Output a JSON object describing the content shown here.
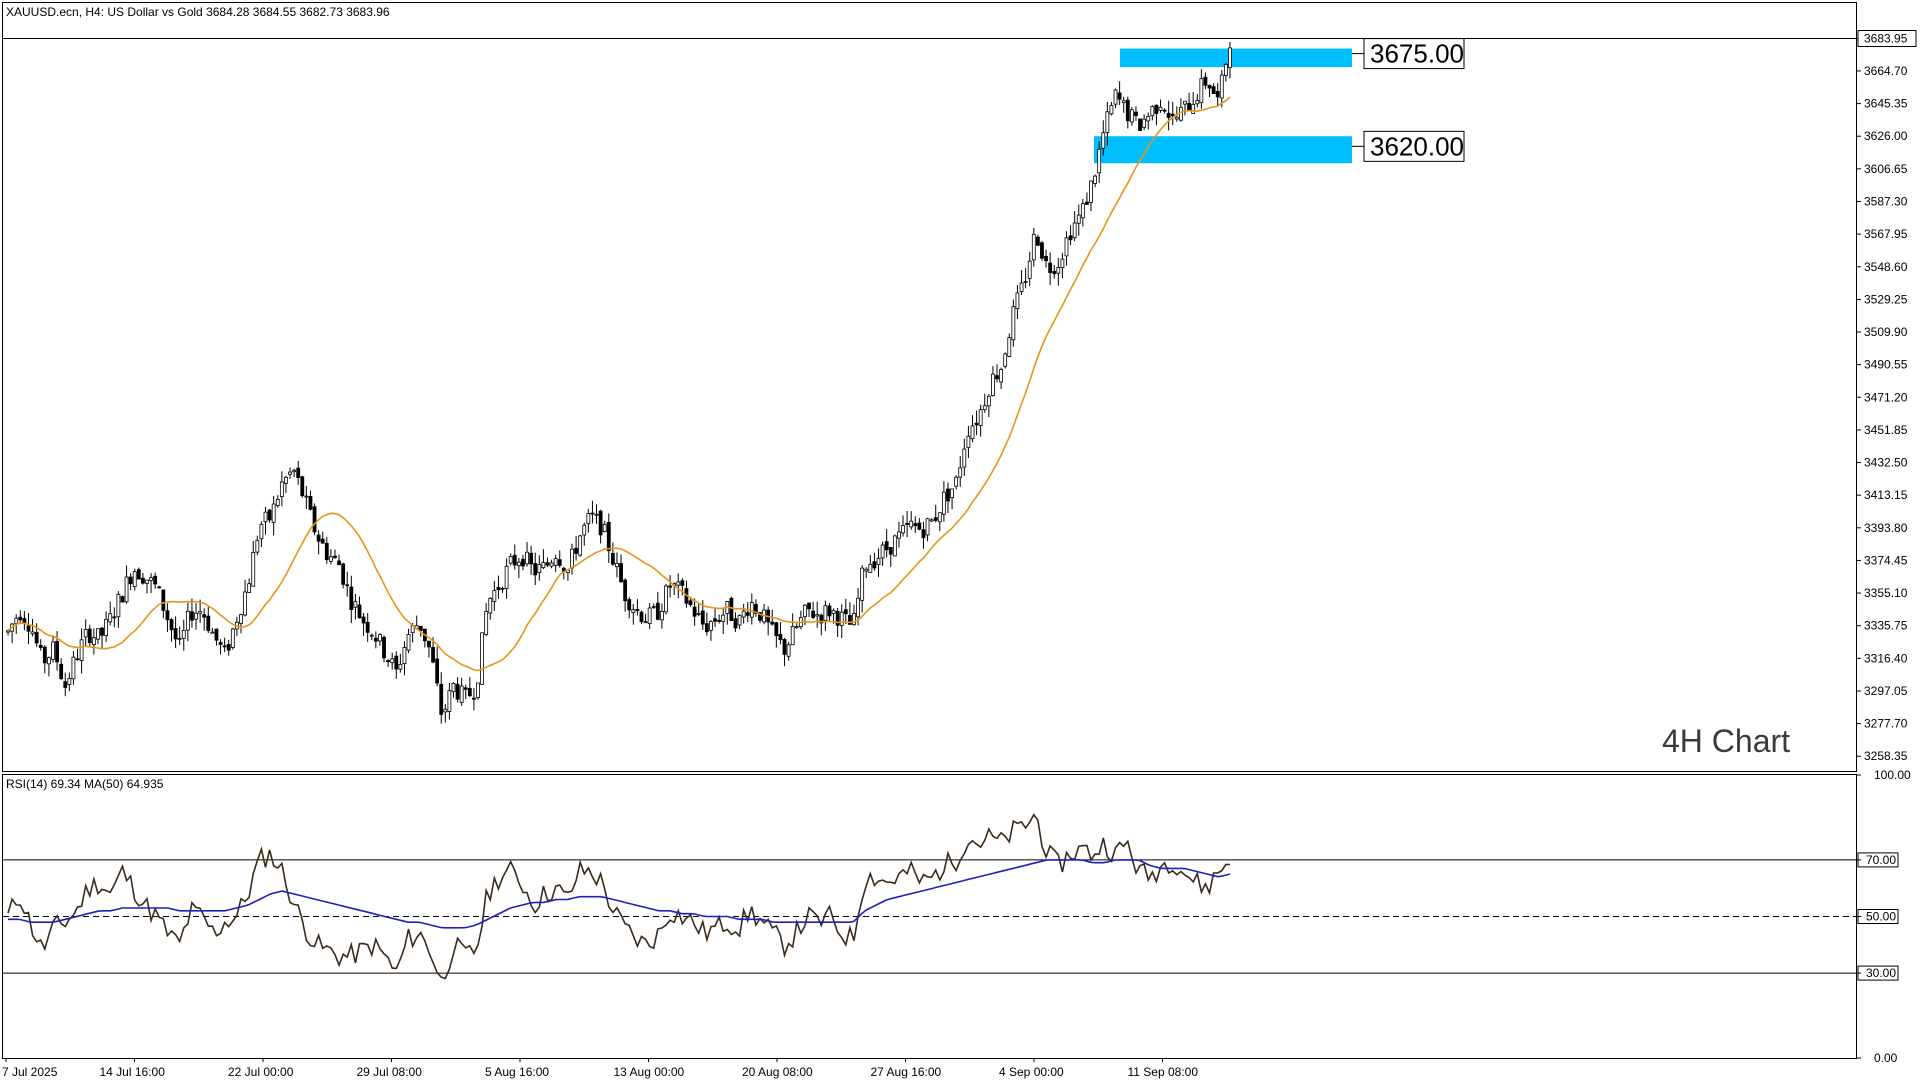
{
  "header": {
    "instrument_info": "XAUUSD.ecn, H4:  US Dollar vs Gold  3684.28 3684.55 3682.73 3683.96"
  },
  "annotation": {
    "timeframe_label": "4H Chart"
  },
  "colors": {
    "bull_candle": "#000000",
    "bear_candle": "#000000",
    "ma_line": "#e8941a",
    "zone_fill": "#00bfff",
    "rsi_line": "#3a2a1a",
    "rsi_ma_line": "#1f1fbf",
    "frame": "#000000"
  },
  "chart_data": [
    {
      "type": "candlestick",
      "title": "XAUUSD.ecn, H4",
      "ylim": [
        3249,
        3705
      ],
      "y_ticks": [
        "3683.95",
        "3664.70",
        "3645.35",
        "3626.00",
        "3606.65",
        "3587.30",
        "3567.95",
        "3548.60",
        "3529.25",
        "3509.90",
        "3490.55",
        "3471.20",
        "3451.85",
        "3432.50",
        "3413.15",
        "3393.80",
        "3374.45",
        "3355.10",
        "3335.75",
        "3316.40",
        "3297.05",
        "3277.70",
        "3258.35"
      ],
      "x_ticks": [
        "7 Jul 2025",
        "14 Jul 16:00",
        "22 Jul 00:00",
        "29 Jul 08:00",
        "5 Aug 16:00",
        "13 Aug 00:00",
        "20 Aug 08:00",
        "27 Aug 16:00",
        "4 Sep 00:00",
        "11 Sep 08:00"
      ],
      "current_price": "3683.95",
      "moving_average_color": "orange",
      "zones": [
        {
          "label": "3675.00",
          "low": 3667,
          "high": 3678
        },
        {
          "label": "3620.00",
          "low": 3610,
          "high": 3626
        }
      ],
      "close_series_approx": [
        3332,
        3345,
        3336,
        3314,
        3322,
        3300,
        3318,
        3332,
        3328,
        3340,
        3355,
        3370,
        3365,
        3358,
        3340,
        3322,
        3344,
        3345,
        3330,
        3318,
        3340,
        3360,
        3395,
        3400,
        3420,
        3428,
        3410,
        3390,
        3378,
        3372,
        3352,
        3340,
        3332,
        3320,
        3308,
        3330,
        3338,
        3320,
        3282,
        3300,
        3292,
        3300,
        3350,
        3360,
        3372,
        3378,
        3368,
        3370,
        3380,
        3368,
        3388,
        3400,
        3395,
        3375,
        3355,
        3345,
        3340,
        3345,
        3360,
        3355,
        3345,
        3335,
        3340,
        3345,
        3338,
        3350,
        3342,
        3330,
        3322,
        3334,
        3345,
        3342,
        3345,
        3340,
        3335,
        3372,
        3376,
        3382,
        3388,
        3395,
        3393,
        3398,
        3412,
        3420,
        3452,
        3460,
        3480,
        3490,
        3520,
        3540,
        3570,
        3548,
        3552,
        3570,
        3580,
        3600,
        3630,
        3650,
        3640,
        3632,
        3640,
        3648,
        3635,
        3642,
        3650,
        3660,
        3646,
        3684
      ]
    },
    {
      "type": "line",
      "title": "RSI(14) 69.34 MA(50) 64.935",
      "ylim": [
        0,
        100
      ],
      "y_ticks": [
        "100.00",
        "70.00",
        "50.00",
        "30.00",
        "0.00"
      ],
      "levels": [
        70,
        50,
        30
      ],
      "series": [
        {
          "name": "RSI(14)",
          "values": [
            50,
            58,
            47,
            38,
            46,
            48,
            52,
            60,
            62,
            58,
            66,
            60,
            54,
            50,
            44,
            40,
            52,
            50,
            44,
            48,
            50,
            58,
            70,
            72,
            66,
            55,
            46,
            40,
            38,
            36,
            36,
            38,
            40,
            36,
            30,
            42,
            44,
            38,
            26,
            40,
            36,
            38,
            58,
            64,
            66,
            62,
            54,
            58,
            60,
            56,
            66,
            66,
            62,
            52,
            46,
            42,
            40,
            44,
            52,
            50,
            48,
            44,
            46,
            48,
            46,
            52,
            48,
            44,
            40,
            44,
            50,
            48,
            50,
            44,
            42,
            64,
            64,
            62,
            64,
            66,
            62,
            64,
            68,
            70,
            78,
            76,
            78,
            76,
            80,
            82,
            86,
            72,
            68,
            72,
            74,
            72,
            76,
            72,
            76,
            66,
            64,
            68,
            70,
            66,
            62,
            60,
            66,
            70
          ]
        },
        {
          "name": "MA(50)",
          "values": [
            49,
            49,
            48,
            48,
            48,
            49,
            50,
            51,
            52,
            52,
            53,
            53,
            53,
            53,
            53,
            52,
            52,
            52,
            52,
            52,
            53,
            54,
            56,
            58,
            59,
            58,
            57,
            56,
            55,
            54,
            53,
            52,
            51,
            50,
            49,
            48,
            48,
            47,
            46,
            46,
            46,
            47,
            49,
            51,
            53,
            54,
            55,
            55,
            56,
            56,
            57,
            57,
            57,
            56,
            55,
            54,
            53,
            52,
            52,
            51,
            51,
            50,
            50,
            50,
            49,
            49,
            49,
            48,
            48,
            48,
            48,
            48,
            48,
            48,
            48,
            52,
            54,
            56,
            57,
            58,
            59,
            60,
            61,
            62,
            63,
            64,
            65,
            66,
            67,
            68,
            69,
            70,
            70,
            70,
            70,
            69,
            69,
            70,
            70,
            70,
            68,
            67,
            67,
            67,
            66,
            65,
            64,
            65
          ]
        }
      ]
    }
  ]
}
